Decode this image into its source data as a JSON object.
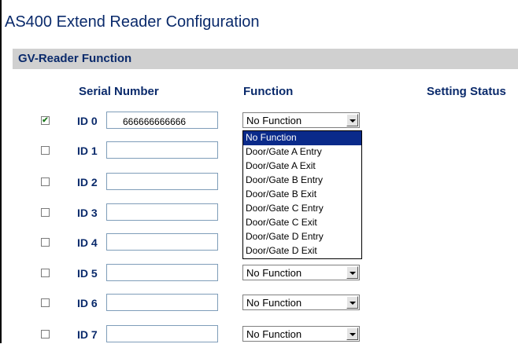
{
  "page": {
    "title": "AS400 Extend Reader Configuration"
  },
  "section": {
    "title": "GV-Reader Function"
  },
  "columns": {
    "serial_number": "Serial Number",
    "function": "Function",
    "setting_status": "Setting Status"
  },
  "rows": [
    {
      "checked": true,
      "id_label": "ID 0",
      "serial": "666666666666",
      "function": "No Function"
    },
    {
      "checked": false,
      "id_label": "ID 1",
      "serial": "",
      "function": ""
    },
    {
      "checked": false,
      "id_label": "ID 2",
      "serial": "",
      "function": ""
    },
    {
      "checked": false,
      "id_label": "ID 3",
      "serial": "",
      "function": ""
    },
    {
      "checked": false,
      "id_label": "ID 4",
      "serial": "",
      "function": ""
    },
    {
      "checked": false,
      "id_label": "ID 5",
      "serial": "",
      "function": "No Function"
    },
    {
      "checked": false,
      "id_label": "ID 6",
      "serial": "",
      "function": "No Function"
    },
    {
      "checked": false,
      "id_label": "ID 7",
      "serial": "",
      "function": "No Function"
    }
  ],
  "dropdown": {
    "options": [
      "No Function",
      "Door/Gate A Entry",
      "Door/Gate A Exit",
      "Door/Gate B Entry",
      "Door/Gate B Exit",
      "Door/Gate C Entry",
      "Door/Gate C Exit",
      "Door/Gate D Entry",
      "Door/Gate D Exit"
    ],
    "selected": "No Function"
  },
  "colors": {
    "heading": "#0a2a6b",
    "section_bg": "#d0d0d0",
    "selection": "#0a2a8a",
    "check": "#1d7a1d"
  }
}
